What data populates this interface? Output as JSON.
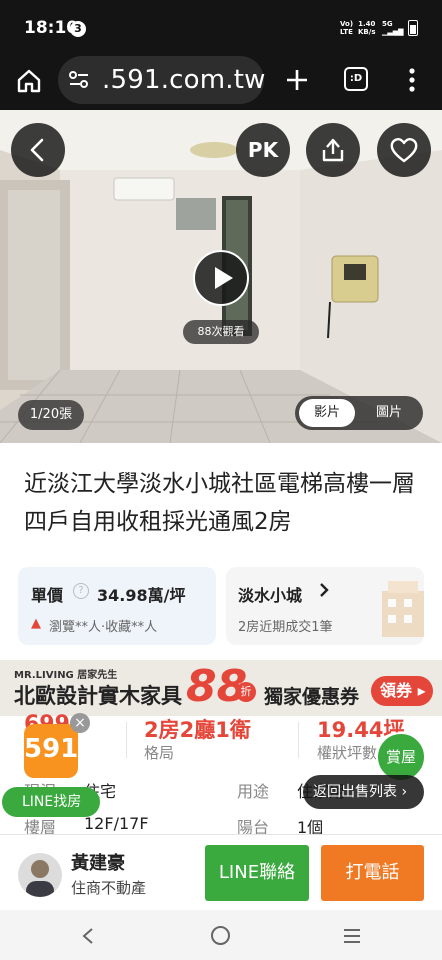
{
  "status": {
    "time": "18:10",
    "notif_count": "3",
    "net": "Vo) LTE",
    "speed_top": "1.40",
    "speed_bottom": "KB/s",
    "fiveg": "5G"
  },
  "browser": {
    "domain": ".591.com.tw"
  },
  "hero": {
    "pk_label": "PK",
    "views": "88次觀看",
    "counter": "1/20張",
    "toggle": {
      "video": "影片",
      "photo": "圖片"
    }
  },
  "listing": {
    "title": "近淡江大學淡水小城社區電梯高樓一層四戶自用收租採光通風2房"
  },
  "price_card": {
    "label": "單價",
    "value": "34.98萬/坪",
    "stats": "瀏覽**人·收藏**人"
  },
  "community_card": {
    "name": "淡水小城",
    "note": "2房近期成交1筆"
  },
  "banner": {
    "brand": "MR.LIVING 居家先生",
    "text_left": "北歐設計實木家具",
    "big_num": "88",
    "zhe": "折",
    "text_right": "獨家優惠券",
    "cta": "領券"
  },
  "stats": {
    "price_partial": "699",
    "layout_value": "2房2廳1衛",
    "layout_label": "格局",
    "area_value": "19.44坪",
    "area_label": "權狀坪數"
  },
  "details": {
    "type_label": "現況",
    "type_value": "住宅",
    "use_label": "用途",
    "use_value": "住家用",
    "floor_label": "樓層",
    "floor_value": "12F/17F",
    "balcony_label": "陽台",
    "balcony_value": "1個"
  },
  "floating": {
    "logo": "591",
    "line_find": "LINE找房",
    "watch": "賞屋",
    "back_to_list": "返回出售列表"
  },
  "agent": {
    "name": "黃建豪",
    "company": "住商不動產",
    "line_btn": "LINE聯絡",
    "call_btn": "打電話"
  },
  "colors": {
    "line_green": "#3aaa3f",
    "call_orange": "#f07a24",
    "accent_red": "#e4463a"
  }
}
